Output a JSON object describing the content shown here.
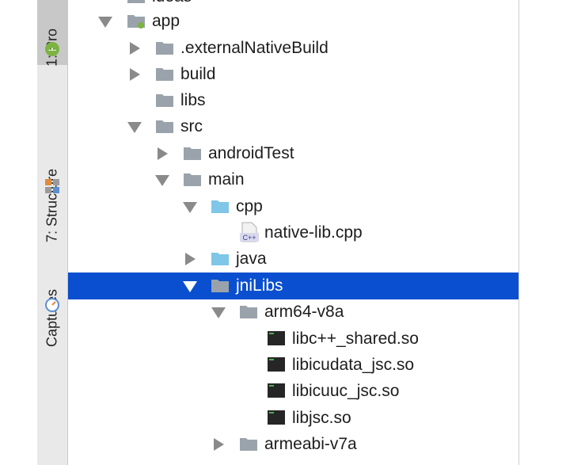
{
  "tool_window_tabs": [
    {
      "label": "1: Pro"
    },
    {
      "label": "7: Structure"
    },
    {
      "label": "Captures"
    }
  ],
  "tree": {
    "rows": [
      {
        "label": "ideas"
      },
      {
        "label": "app"
      },
      {
        "label": ".externalNativeBuild"
      },
      {
        "label": "build"
      },
      {
        "label": "libs"
      },
      {
        "label": "src"
      },
      {
        "label": "androidTest"
      },
      {
        "label": "main"
      },
      {
        "label": "cpp"
      },
      {
        "label": "native-lib.cpp",
        "icon_text": "C++"
      },
      {
        "label": "java"
      },
      {
        "label": "jniLibs"
      },
      {
        "label": "arm64-v8a"
      },
      {
        "label": "libc++_shared.so"
      },
      {
        "label": "libicudata_jsc.so"
      },
      {
        "label": "libicuuc_jsc.so"
      },
      {
        "label": "libjsc.so"
      },
      {
        "label": "armeabi-v7a"
      }
    ]
  },
  "colors": {
    "selection": "#0a4fcf",
    "folder": "#9aa3ab",
    "source_folder": "#7fc6e8",
    "tool_strip": "#e9e9e9"
  },
  "icons": [
    "android-icon",
    "structure-icon",
    "captures-icon",
    "folder-icon",
    "source-folder-icon",
    "cpp-file-icon",
    "so-file-icon",
    "expand-arrow-icon",
    "collapse-arrow-icon"
  ]
}
